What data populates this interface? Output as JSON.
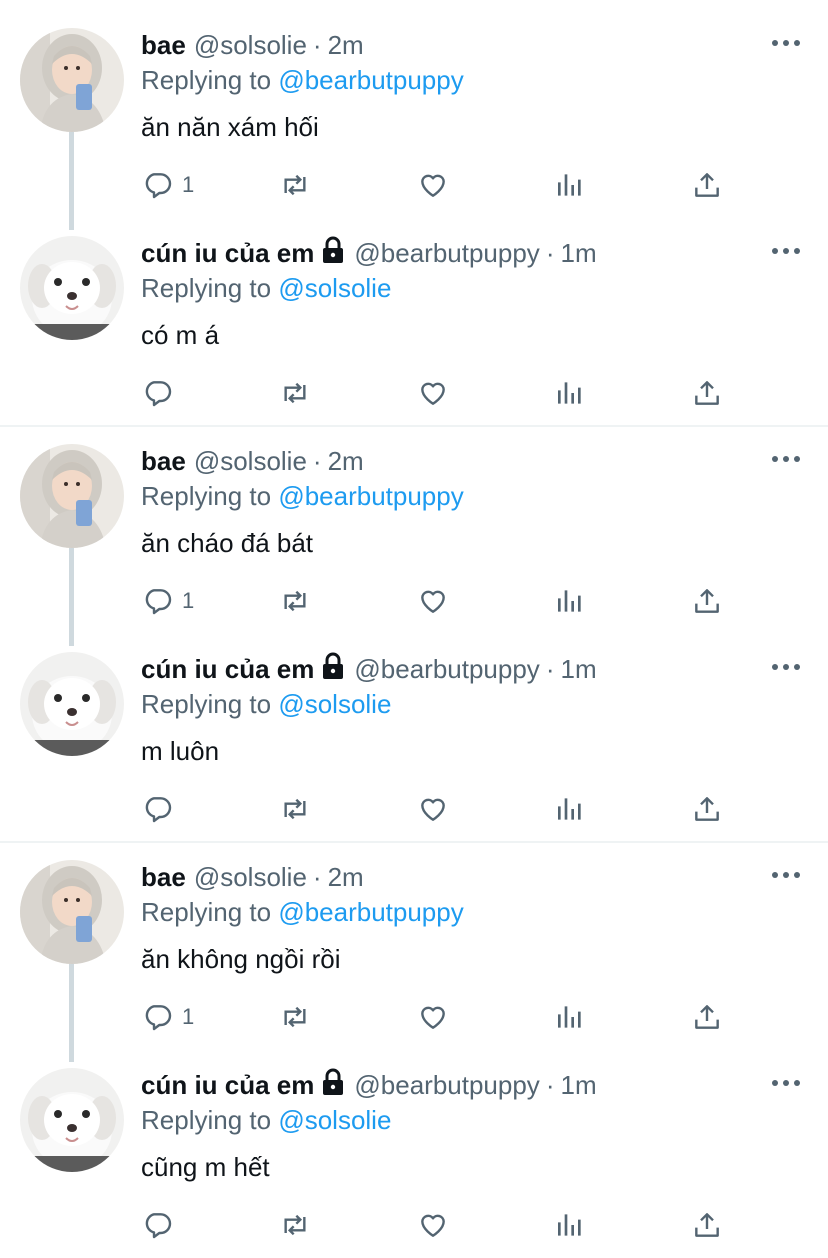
{
  "colors": {
    "link": "#1d9bf0",
    "secondary": "#536471",
    "primary_text": "#0f1419",
    "thread_line": "#cfd9de"
  },
  "icons": [
    "reply-icon",
    "retweet-icon",
    "like-icon",
    "analytics-icon",
    "share-icon",
    "more-icon",
    "lock-icon"
  ],
  "tweets": [
    {
      "name": "bae",
      "handle": "@solsolie",
      "dot": "·",
      "time": "2m",
      "replying_label": "Replying to",
      "replying_to": "@bearbutpuppy",
      "text": "ăn năn xám hối",
      "reply_count": "1"
    },
    {
      "name": "cún iu của em",
      "handle": "@bearbutpuppy",
      "dot": "·",
      "time": "1m",
      "replying_label": "Replying to",
      "replying_to": "@solsolie",
      "text": "có m á",
      "reply_count": ""
    },
    {
      "name": "bae",
      "handle": "@solsolie",
      "dot": "·",
      "time": "2m",
      "replying_label": "Replying to",
      "replying_to": "@bearbutpuppy",
      "text": "ăn cháo đá bát",
      "reply_count": "1"
    },
    {
      "name": "cún iu của em",
      "handle": "@bearbutpuppy",
      "dot": "·",
      "time": "1m",
      "replying_label": "Replying to",
      "replying_to": "@solsolie",
      "text": "m luôn",
      "reply_count": ""
    },
    {
      "name": "bae",
      "handle": "@solsolie",
      "dot": "·",
      "time": "2m",
      "replying_label": "Replying to",
      "replying_to": "@bearbutpuppy",
      "text": "ăn không ngồi rồi",
      "reply_count": "1"
    },
    {
      "name": "cún iu của em",
      "handle": "@bearbutpuppy",
      "dot": "·",
      "time": "1m",
      "replying_label": "Replying to",
      "replying_to": "@solsolie",
      "text": "cũng m hết",
      "reply_count": ""
    }
  ]
}
